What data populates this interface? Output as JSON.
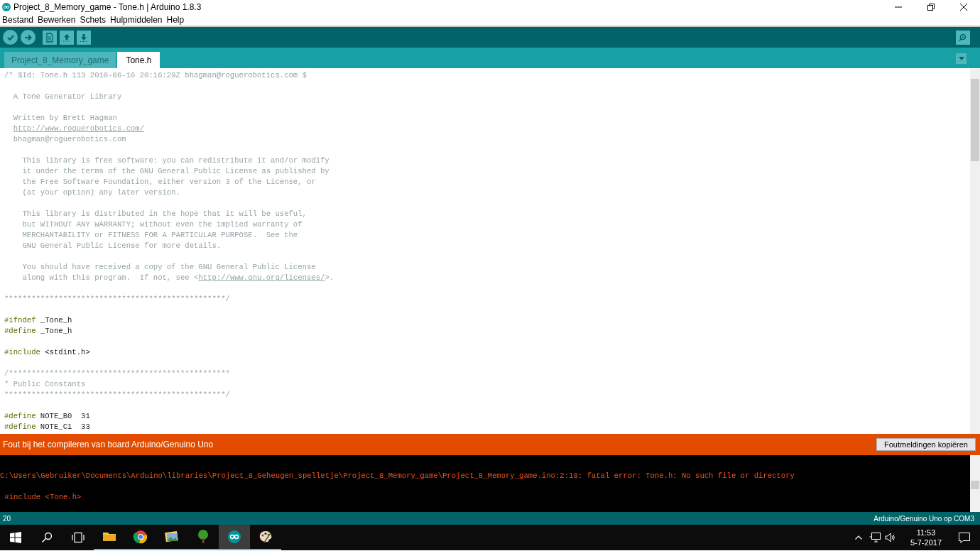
{
  "window": {
    "title": "Project_8_Memory_game - Tone.h | Arduino 1.8.3"
  },
  "menu": [
    "Bestand",
    "Bewerken",
    "Schets",
    "Hulpmiddelen",
    "Help"
  ],
  "toolbar": [
    {
      "kind": "verify"
    },
    {
      "kind": "upload"
    },
    {
      "kind": "new"
    },
    {
      "kind": "open"
    },
    {
      "kind": "save"
    }
  ],
  "tabs": [
    {
      "label": "Project_8_Memory_game",
      "selected": false
    },
    {
      "label": "Tone.h",
      "selected": true
    }
  ],
  "editor": {
    "lines": [
      {
        "kind": "code",
        "spans": [
          {
            "kind": "comment",
            "text": "/* $Id: Tone.h 113 2010-06-16 20:16:29Z bhagman@roguerobotics.com $"
          }
        ]
      },
      {
        "kind": "blank"
      },
      {
        "kind": "code",
        "spans": [
          {
            "kind": "comment",
            "text": "  A Tone Generator Library"
          }
        ]
      },
      {
        "kind": "blank"
      },
      {
        "kind": "code",
        "spans": [
          {
            "kind": "comment",
            "text": "  Written by Brett Hagman"
          }
        ]
      },
      {
        "kind": "code_indented",
        "spans": [
          {
            "kind": "link",
            "text": "http://www.roguerobotics.com/"
          }
        ]
      },
      {
        "kind": "code",
        "spans": [
          {
            "kind": "comment",
            "text": "  bhagman@roguerobotics.com"
          }
        ]
      },
      {
        "kind": "blank"
      },
      {
        "kind": "code",
        "spans": [
          {
            "kind": "comment",
            "text": "    This library is free software: you can redistribute it and/or modify"
          }
        ]
      },
      {
        "kind": "code",
        "spans": [
          {
            "kind": "comment",
            "text": "    it under the terms of the GNU General Public License as published by"
          }
        ]
      },
      {
        "kind": "code",
        "spans": [
          {
            "kind": "comment",
            "text": "    the Free Software Foundation, either version 3 of the License, or"
          }
        ]
      },
      {
        "kind": "code",
        "spans": [
          {
            "kind": "comment",
            "text": "    (at your option) any later version."
          }
        ]
      },
      {
        "kind": "blank"
      },
      {
        "kind": "code",
        "spans": [
          {
            "kind": "comment",
            "text": "    This library is distributed in the hope that it will be useful,"
          }
        ]
      },
      {
        "kind": "code",
        "spans": [
          {
            "kind": "comment",
            "text": "    but WITHOUT ANY WARRANTY; without even the implied warranty of"
          }
        ]
      },
      {
        "kind": "code",
        "spans": [
          {
            "kind": "comment",
            "text": "    MERCHANTABILITY or FITNESS FOR A PARTICULAR PURPOSE.  See the"
          }
        ]
      },
      {
        "kind": "code",
        "spans": [
          {
            "kind": "comment",
            "text": "    GNU General Public License for more details."
          }
        ]
      },
      {
        "kind": "blank"
      },
      {
        "kind": "code",
        "spans": [
          {
            "kind": "comment",
            "text": "    You should have received a copy of the GNU General Public License"
          }
        ]
      },
      {
        "kind": "code",
        "spans": [
          {
            "kind": "comment",
            "text": "    along with this program.  If not, see <"
          },
          {
            "kind": "link",
            "text": "http://www.gnu.org/licenses/"
          },
          {
            "kind": "comment",
            "text": ">."
          }
        ]
      },
      {
        "kind": "blank"
      },
      {
        "kind": "code",
        "spans": [
          {
            "kind": "comment",
            "text": "*************************************************/"
          }
        ]
      },
      {
        "kind": "blank"
      },
      {
        "kind": "code",
        "spans": [
          {
            "kind": "keyword",
            "text": "#ifndef"
          },
          {
            "kind": "plain",
            "text": " _Tone_h"
          }
        ]
      },
      {
        "kind": "code",
        "spans": [
          {
            "kind": "keyword",
            "text": "#define"
          },
          {
            "kind": "plain",
            "text": " _Tone_h"
          }
        ]
      },
      {
        "kind": "blank"
      },
      {
        "kind": "code",
        "spans": [
          {
            "kind": "keyword",
            "text": "#include"
          },
          {
            "kind": "plain",
            "text": " <stdint.h>"
          }
        ]
      },
      {
        "kind": "blank"
      },
      {
        "kind": "code",
        "spans": [
          {
            "kind": "comment",
            "text": "/*************************************************"
          }
        ]
      },
      {
        "kind": "code",
        "spans": [
          {
            "kind": "comment",
            "text": "* Public Constants"
          }
        ]
      },
      {
        "kind": "code",
        "spans": [
          {
            "kind": "comment",
            "text": "*************************************************/"
          }
        ]
      },
      {
        "kind": "blank"
      },
      {
        "kind": "code",
        "spans": [
          {
            "kind": "keyword",
            "text": "#define"
          },
          {
            "kind": "plain",
            "text": " NOTE_B0  31"
          }
        ]
      },
      {
        "kind": "code",
        "spans": [
          {
            "kind": "keyword",
            "text": "#define"
          },
          {
            "kind": "plain",
            "text": " NOTE_C1  33"
          }
        ]
      }
    ]
  },
  "message_bar": {
    "text": "Fout bij het compileren van board Arduino/Genuino Uno",
    "button": "Foutmeldingen kopiëren"
  },
  "console": {
    "lines": [
      "C:\\Users\\Gebruiker\\Documents\\Arduino\\libraries\\Project_8_Geheugen_spelletje\\Project_8_Memory_game\\Project_8_Memory_game.ino:2:18: fatal error: Tone.h: No such file or directory",
      " #include <Tone.h>"
    ]
  },
  "status_bar": {
    "line": "20",
    "board": "Arduino/Genuino Uno op COM3"
  },
  "taskbar": {
    "apps": [
      {
        "kind": "folder",
        "selected": false
      },
      {
        "kind": "browser",
        "selected": false
      },
      {
        "kind": "photos",
        "selected": false
      },
      {
        "kind": "tree",
        "selected": false
      },
      {
        "kind": "arduino",
        "selected": true
      },
      {
        "kind": "paint",
        "selected": false
      }
    ],
    "time": "11:53",
    "date": "5-7-2017"
  }
}
